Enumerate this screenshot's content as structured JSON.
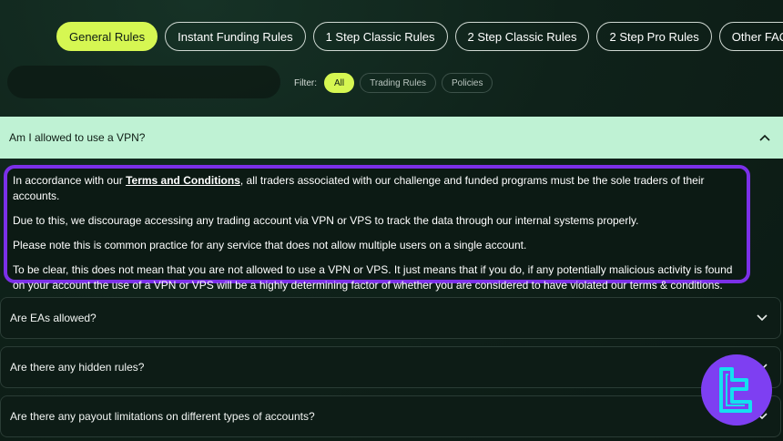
{
  "tabs": [
    {
      "label": "General Rules",
      "active": true
    },
    {
      "label": "Instant Funding Rules",
      "active": false
    },
    {
      "label": "1 Step Classic Rules",
      "active": false
    },
    {
      "label": "2 Step Classic Rules",
      "active": false
    },
    {
      "label": "2 Step Pro Rules",
      "active": false
    },
    {
      "label": "Other FAQs",
      "active": false
    }
  ],
  "filter": {
    "label": "Filter:",
    "options": [
      "All",
      "Trading Rules",
      "Policies"
    ],
    "selected": "All"
  },
  "faq": {
    "open_question": "Am I allowed to use a VPN?",
    "answer": {
      "p1_before": "In accordance with our ",
      "p1_link": "Terms and Conditions",
      "p1_after": ", all traders associated with our challenge and funded programs must be the sole traders of their accounts.",
      "p2": "Due to this, we discourage accessing any trading account via VPN or VPS to track the data through our internal systems properly.",
      "p3": "Please note this is common practice for any service that does not allow multiple users on a single account.",
      "p4": "To be clear, this does not mean that you are not allowed to use a VPN or VPS. It just means that if you do, if any potentially malicious activity is found on your account the use of a VPN or VPS will be a highly determining factor of whether you are considered to have violated our terms & conditions."
    },
    "questions": [
      "Are EAs allowed?",
      "Are there any hidden rules?",
      "Are there any payout limitations on different types of accounts?"
    ]
  },
  "colors": {
    "accent": "#d6f752",
    "open_header_bg": "#bff2d4",
    "highlight_border": "#7b30e8",
    "logo_bg": "#7e3ff2",
    "logo_fg": "#14e0f0"
  },
  "icons": [
    "chevron-up-icon",
    "chevron-down-icon",
    "brand-logo"
  ]
}
